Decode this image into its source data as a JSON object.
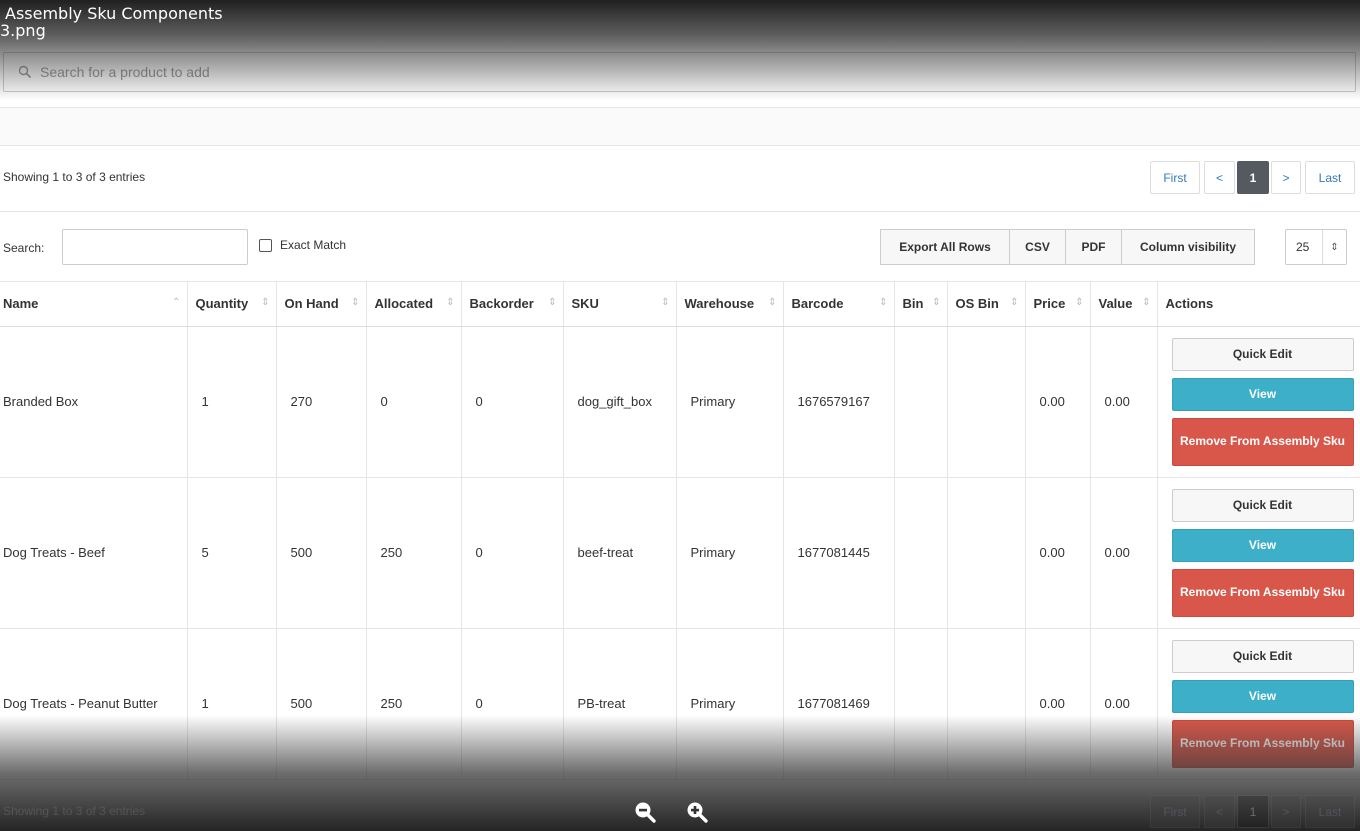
{
  "viewer": {
    "title": "Assembly Sku Components",
    "filename": "3.png",
    "zoom_out_icon": "zoom-out-icon",
    "zoom_in_icon": "zoom-in-icon"
  },
  "product_search": {
    "placeholder": "Search for a product to add",
    "icon": "search-icon"
  },
  "table_info": "Showing 1 to 3 of 3 entries",
  "pagination": {
    "first": "First",
    "prev": "<",
    "current": "1",
    "next": ">",
    "last": "Last"
  },
  "toolbar": {
    "search_label": "Search:",
    "search_value": "",
    "exact_match_label": "Exact Match",
    "exact_match_checked": false,
    "buttons": [
      "Export All Rows",
      "CSV",
      "PDF",
      "Column visibility"
    ],
    "page_length": "25"
  },
  "columns": [
    "Name",
    "Quantity",
    "On Hand",
    "Allocated",
    "Backorder",
    "SKU",
    "Warehouse",
    "Barcode",
    "Bin",
    "OS Bin",
    "Price",
    "Value",
    "Actions"
  ],
  "rows": [
    {
      "name": "Branded Box",
      "quantity": "1",
      "on_hand": "270",
      "allocated": "0",
      "backorder": "0",
      "sku": "dog_gift_box",
      "warehouse": "Primary",
      "barcode": "1676579167",
      "bin": "",
      "os_bin": "",
      "price": "0.00",
      "value": "0.00"
    },
    {
      "name": "Dog Treats - Beef",
      "quantity": "5",
      "on_hand": "500",
      "allocated": "250",
      "backorder": "0",
      "sku": "beef-treat",
      "warehouse": "Primary",
      "barcode": "1677081445",
      "bin": "",
      "os_bin": "",
      "price": "0.00",
      "value": "0.00"
    },
    {
      "name": "Dog Treats - Peanut Butter",
      "quantity": "1",
      "on_hand": "500",
      "allocated": "250",
      "backorder": "0",
      "sku": "PB-treat",
      "warehouse": "Primary",
      "barcode": "1677081469",
      "bin": "",
      "os_bin": "",
      "price": "0.00",
      "value": "0.00"
    }
  ],
  "row_actions": {
    "quick_edit": "Quick Edit",
    "view": "View",
    "remove": "Remove From Assembly Sku"
  },
  "colors": {
    "view_button": "#3eafc9",
    "remove_button": "#d9574a",
    "active_page": "#555a60",
    "link": "#337ab7"
  }
}
